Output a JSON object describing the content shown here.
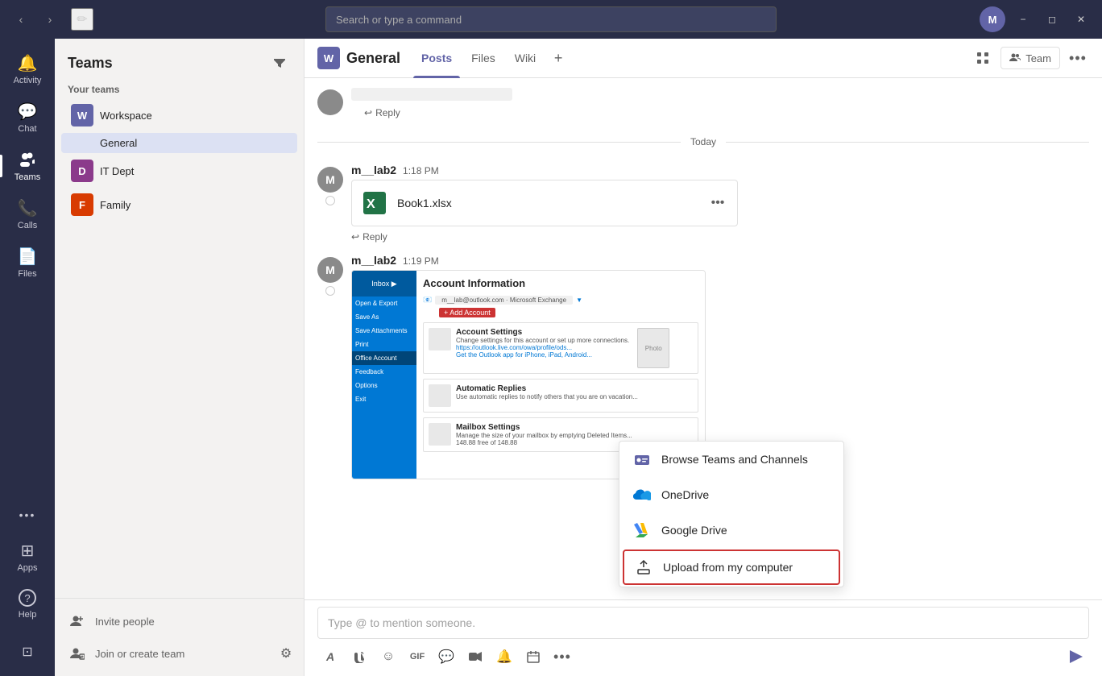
{
  "titleBar": {
    "searchPlaceholder": "Search or type a command",
    "avatarInitial": "M"
  },
  "navSidebar": {
    "items": [
      {
        "id": "activity",
        "label": "Activity",
        "icon": "🔔"
      },
      {
        "id": "chat",
        "label": "Chat",
        "icon": "💬"
      },
      {
        "id": "teams",
        "label": "Teams",
        "icon": "👥"
      },
      {
        "id": "calls",
        "label": "Calls",
        "icon": "📞"
      },
      {
        "id": "files",
        "label": "Files",
        "icon": "📄"
      }
    ],
    "bottomItems": [
      {
        "id": "more",
        "label": "...",
        "icon": "···"
      },
      {
        "id": "apps",
        "label": "Apps",
        "icon": "⊞"
      },
      {
        "id": "help",
        "label": "Help",
        "icon": "?"
      },
      {
        "id": "manage",
        "label": "",
        "icon": "⊡"
      }
    ]
  },
  "teamsPanel": {
    "title": "Teams",
    "filterLabel": "Filter",
    "sectionLabel": "Your teams",
    "teams": [
      {
        "id": "workspace",
        "name": "Workspace",
        "initial": "W",
        "color": "#6264a7"
      },
      {
        "id": "itdept",
        "name": "IT Dept",
        "initial": "D",
        "color": "#8b3a8b"
      },
      {
        "id": "family",
        "name": "Family",
        "initial": "F",
        "color": "#d83b01"
      }
    ],
    "channels": [
      {
        "id": "general",
        "name": "General",
        "teamId": "workspace"
      }
    ],
    "bottomActions": [
      {
        "id": "invite",
        "label": "Invite people",
        "icon": "👤"
      },
      {
        "id": "join",
        "label": "Join or create team",
        "icon": "👥"
      }
    ],
    "settingsLabel": "⚙"
  },
  "channelHeader": {
    "teamInitial": "W",
    "teamColor": "#6264a7",
    "channelName": "General",
    "tabs": [
      {
        "id": "posts",
        "label": "Posts",
        "active": true
      },
      {
        "id": "files",
        "label": "Files",
        "active": false
      },
      {
        "id": "wiki",
        "label": "Wiki",
        "active": false
      }
    ],
    "teamButtonLabel": "Team",
    "moreIcon": "···"
  },
  "messages": {
    "dateDivider": "Today",
    "messages": [
      {
        "id": "msg1",
        "avatar": "M",
        "author": "m__lab2",
        "time": "1:18 PM",
        "hasAttachment": true,
        "attachmentName": "Book1.xlsx",
        "replyLabel": "Reply"
      },
      {
        "id": "msg2",
        "avatar": "M",
        "author": "m__lab2",
        "time": "1:19 PM",
        "hasImage": true,
        "replyLabel": "Reply"
      }
    ]
  },
  "dropdown": {
    "items": [
      {
        "id": "browse",
        "label": "Browse Teams and Channels",
        "icon": "teams"
      },
      {
        "id": "onedrive",
        "label": "OneDrive",
        "icon": "onedrive"
      },
      {
        "id": "googledrive",
        "label": "Google Drive",
        "icon": "googledrive"
      },
      {
        "id": "upload",
        "label": "Upload from my computer",
        "icon": "upload",
        "highlighted": true
      }
    ]
  },
  "messageInput": {
    "placeholder": "Type @ to mention someone.",
    "tools": [
      "A",
      "📎",
      "😊",
      "GIF",
      "💬",
      "🎥",
      "🔔",
      "📋",
      "···"
    ],
    "sendIcon": "➤"
  }
}
